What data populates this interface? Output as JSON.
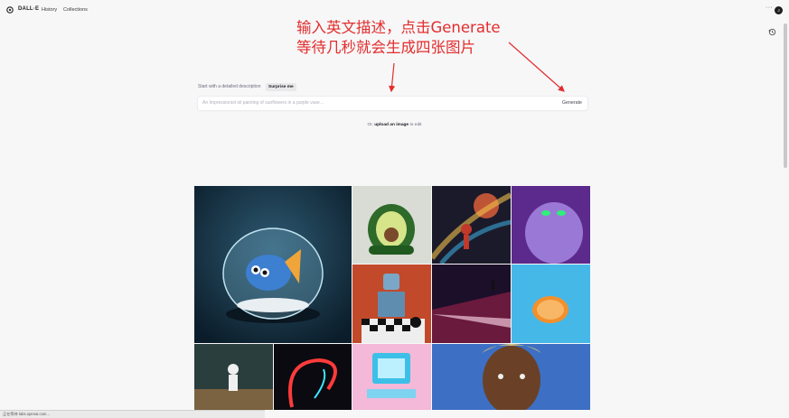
{
  "header": {
    "brand": "DALL·E",
    "nav": [
      "History",
      "Collections"
    ],
    "more_icon": "more-icon",
    "avatar_initial": "J"
  },
  "annotation": {
    "line1": "输入英文描述，点击Generate",
    "line2": "等待几秒就会生成四张图片",
    "color": "#e32d2d"
  },
  "prompt": {
    "label": "Start with a detailed description",
    "surprise_label": "Surprise me",
    "placeholder": "An Impressionist oil painting of sunflowers in a purple vase…",
    "generate_label": "Generate"
  },
  "upload": {
    "prefix": "Or,",
    "link": "upload an image",
    "suffix": "to edit"
  },
  "gallery": {
    "items": [
      "fishbowl-fish-image",
      "avocado-armchair-image",
      "cosmic-basketball-image",
      "purple-monster-image",
      "robot-chess-image",
      "sunset-figure-image",
      "orange-half-image",
      "astronaut-desert-image",
      "neon-figure-image",
      "retro-computer-image",
      "painted-portrait-image"
    ]
  },
  "status": {
    "text": "正在等待 labs.openai.com..."
  }
}
